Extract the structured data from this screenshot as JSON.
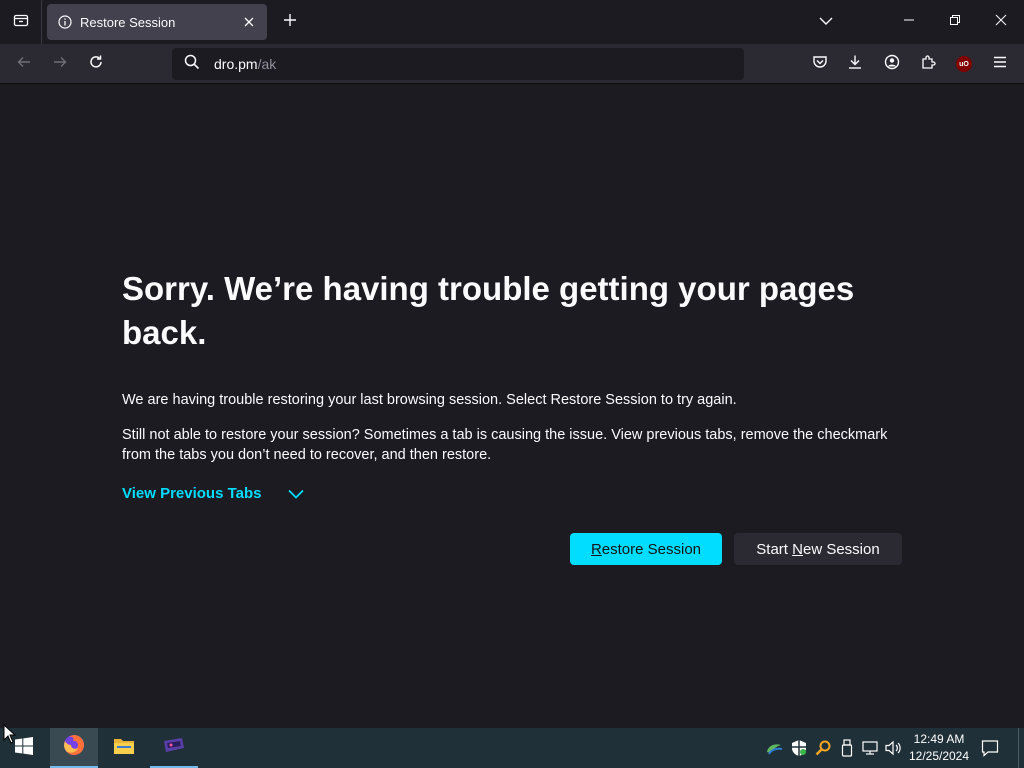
{
  "browser": {
    "tab": {
      "title": "Restore Session"
    },
    "url": {
      "host": "dro.pm",
      "path": "/ak"
    },
    "extension_badge": "uO"
  },
  "page": {
    "heading": "Sorry. We’re having trouble getting your pages back.",
    "paragraph1": "We are having trouble restoring your last browsing session. Select Restore Session to try again.",
    "paragraph2": "Still not able to restore your session? Sometimes a tab is causing the issue. View previous tabs, remove the checkmark from the tabs you don’t need to recover, and then restore.",
    "view_previous_tabs": "View Previous Tabs",
    "restore_button": {
      "access_key": "R",
      "rest": "estore Session"
    },
    "new_session_button": {
      "before": "Start ",
      "access_key": "N",
      "after": "ew Session"
    }
  },
  "taskbar": {
    "time": "12:49 AM",
    "date": "12/25/2024"
  },
  "colors": {
    "accent": "#00ddff",
    "background": "#1c1b22",
    "toolbar": "#2b2a33",
    "taskbar": "#1f3038"
  },
  "icons": [
    "tab-list-icon",
    "info-icon",
    "close-icon",
    "plus-icon",
    "chevron-down-icon",
    "minimize-icon",
    "restore-icon",
    "back-icon",
    "forward-icon",
    "reload-icon",
    "search-icon",
    "pocket-icon",
    "download-icon",
    "account-icon",
    "extensions-icon",
    "ublock-icon",
    "menu-icon",
    "windows-start-icon",
    "firefox-icon",
    "file-explorer-icon",
    "app-icon",
    "network-icon",
    "shield-icon",
    "search-tray-icon",
    "usb-icon",
    "ethernet-icon",
    "volume-icon",
    "notification-icon",
    "mouse-cursor-icon"
  ]
}
